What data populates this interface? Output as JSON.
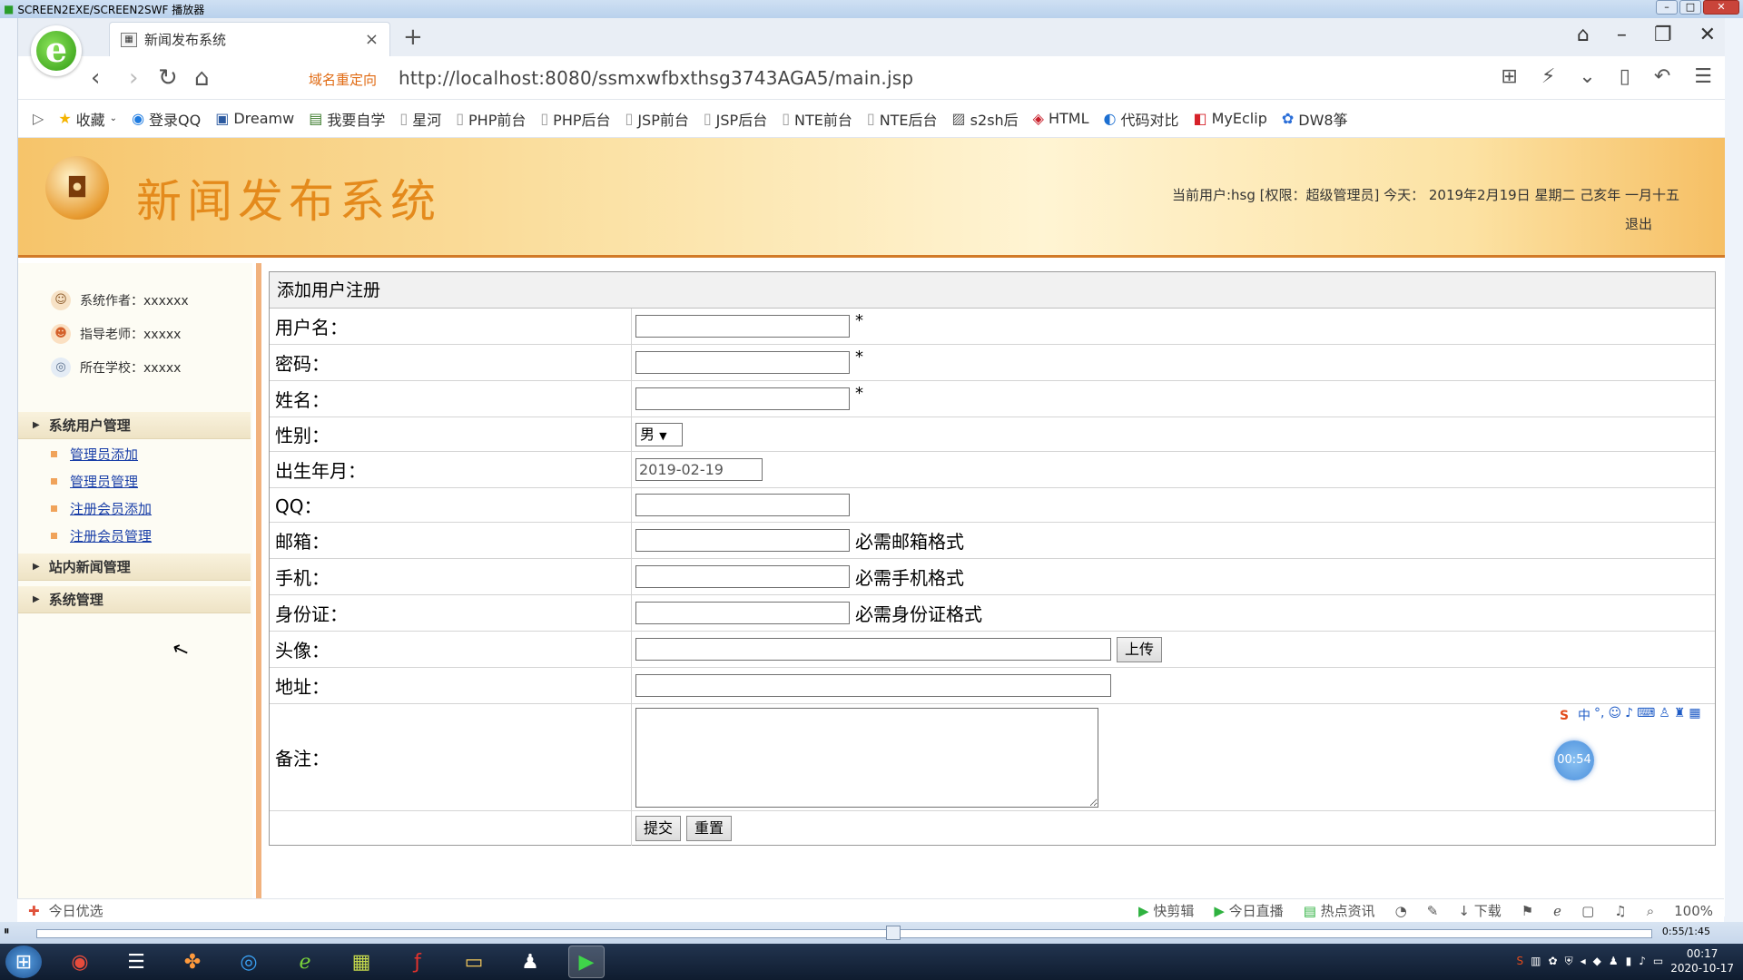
{
  "player": {
    "title": "SCREEN2EXE/SCREEN2SWF 播放器",
    "time": "0:55/1:45"
  },
  "browser": {
    "tab_title": "新闻发布系统",
    "redirect_label": "域名重定向",
    "url": "http://localhost:8080/ssmxwfbxthsg3743AGA5/main.jsp",
    "favorites": [
      {
        "label": "收藏",
        "icon": "star-icon"
      },
      {
        "label": "登录QQ",
        "icon": "qq-icon"
      },
      {
        "label": "Dreamw",
        "icon": "dreamweaver-icon"
      },
      {
        "label": "我要自学",
        "icon": "book-icon"
      },
      {
        "label": "星河",
        "icon": "page-icon"
      },
      {
        "label": "PHP前台",
        "icon": "page-icon"
      },
      {
        "label": "PHP后台",
        "icon": "page-icon"
      },
      {
        "label": "JSP前台",
        "icon": "page-icon"
      },
      {
        "label": "JSP后台",
        "icon": "page-icon"
      },
      {
        "label": "NTE前台",
        "icon": "page-icon"
      },
      {
        "label": "NTE后台",
        "icon": "page-icon"
      },
      {
        "label": "s2sh后",
        "icon": "page-icon"
      },
      {
        "label": "HTML",
        "icon": "html-icon"
      },
      {
        "label": "代码对比",
        "icon": "compare-icon"
      },
      {
        "label": "MyEclip",
        "icon": "myeclipse-icon"
      },
      {
        "label": "DW8筝",
        "icon": "paw-icon"
      }
    ],
    "status": {
      "left": "今日优选",
      "items": [
        "快剪辑",
        "今日直播",
        "热点资讯",
        "下载"
      ],
      "zoom": "100%"
    }
  },
  "header": {
    "site_title": "新闻发布系统",
    "user_info": "当前用户:hsg [权限：超级管理员] 今天： 2019年2月19日 星期二 己亥年 一月十五",
    "logout": "退出"
  },
  "sidebar": {
    "info": [
      {
        "label": "系统作者：xxxxxx",
        "icon": "author-icon"
      },
      {
        "label": "指导老师：xxxxx",
        "icon": "teacher-icon"
      },
      {
        "label": "所在学校：xxxxx",
        "icon": "school-icon"
      }
    ],
    "menu_user": "系统用户管理",
    "links": [
      "管理员添加",
      "管理员管理",
      "注册会员添加",
      "注册会员管理"
    ],
    "menu_news": "站内新闻管理",
    "menu_system": "系统管理"
  },
  "form": {
    "title": "添加用户注册",
    "labels": {
      "username": "用户名：",
      "password": "密码：",
      "name": "姓名：",
      "gender": "性别：",
      "birth": "出生年月：",
      "qq": "QQ：",
      "email": "邮箱：",
      "phone": "手机：",
      "idcard": "身份证：",
      "avatar": "头像：",
      "address": "地址：",
      "remark": "备注："
    },
    "required": "*",
    "gender_value": "男",
    "birth_value": "2019-02-19",
    "email_hint": "必需邮箱格式",
    "phone_hint": "必需手机格式",
    "idcard_hint": "必需身份证格式",
    "upload": "上传",
    "submit": "提交",
    "reset": "重置"
  },
  "ime": {
    "lang": "中"
  },
  "timer": "00:54",
  "clock": {
    "time": "00:17",
    "date": "2020-10-17"
  }
}
